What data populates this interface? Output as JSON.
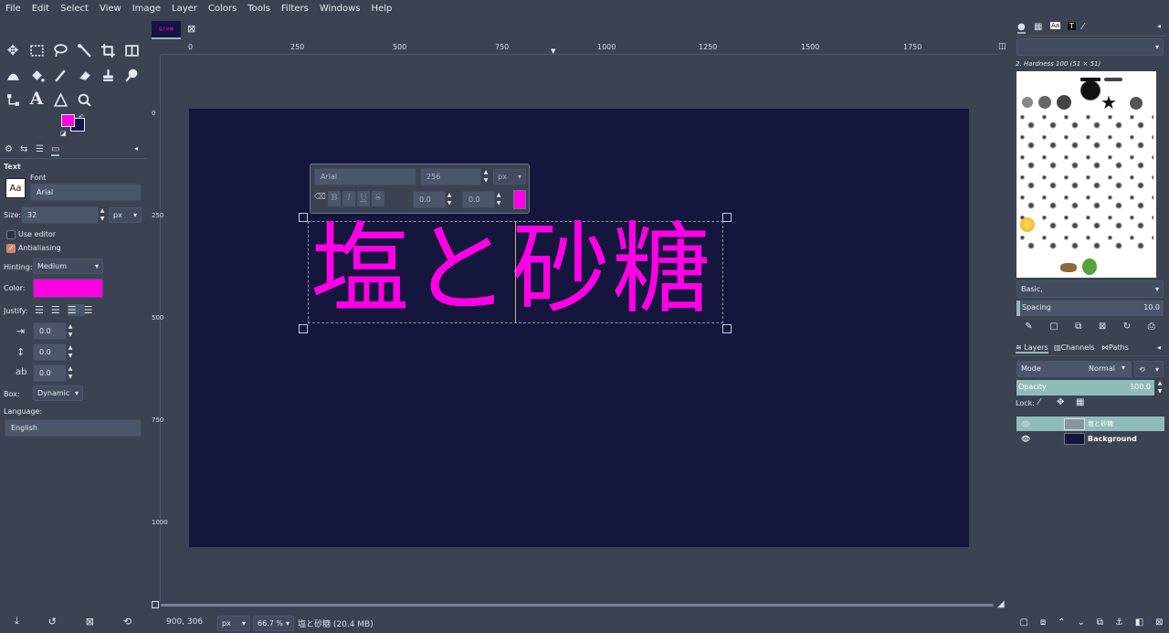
{
  "menu": [
    "File",
    "Edit",
    "Select",
    "View",
    "Image",
    "Layer",
    "Colors",
    "Tools",
    "Filters",
    "Windows",
    "Help"
  ],
  "colors": {
    "fg": "#ff00e6",
    "bg": "#14163e",
    "accent": "#8fbcbb"
  },
  "tool_options": {
    "title": "Text",
    "font_label": "Font",
    "font_value": "Arial",
    "font_icon": "Aa",
    "size_label": "Size:",
    "size_value": "32",
    "size_unit": "px",
    "use_editor": "Use editor",
    "antialiasing": "Antialiasing",
    "hinting_label": "Hinting:",
    "hinting_value": "Medium",
    "color_label": "Color:",
    "justify_label": "Justify:",
    "indent_value": "0.0",
    "line_spacing_value": "0.0",
    "letter_spacing_value": "0.0",
    "box_label": "Box:",
    "box_value": "Dynamic",
    "language_label": "Language:",
    "language_value": "English"
  },
  "image_tab": {
    "thumb_text": "塩と砂糖"
  },
  "ruler": {
    "top": [
      "0",
      "250",
      "500",
      "750",
      "1000",
      "1250",
      "1500",
      "1750"
    ],
    "left": [
      "0",
      "250",
      "500",
      "750",
      "1000"
    ]
  },
  "canvas_text": "塩と砂糖",
  "text_toolbar": {
    "font": "Arial",
    "size": "256",
    "unit": "px",
    "bold": "B",
    "italic": "I",
    "underline": "U",
    "strike": "S",
    "baseline": "0.0",
    "kerning": "0.0"
  },
  "status": {
    "coords": "900, 306",
    "unit": "px",
    "zoom": "66.7 %",
    "info": "塩と砂糖 (20.4 MB)"
  },
  "brushes": {
    "tab_text": "Aa",
    "current": "2. Hardness 100 (51 × 51)",
    "preset": "Basic,",
    "spacing_label": "Spacing",
    "spacing_value": "10.0"
  },
  "layers": {
    "tabs": [
      "Layers",
      "Channels",
      "Paths"
    ],
    "mode_label": "Mode",
    "mode_value": "Normal",
    "opacity_label": "Opacity",
    "opacity_value": "100.0",
    "lock_label": "Lock:",
    "items": [
      {
        "name": "塩と砂糖",
        "selected": true
      },
      {
        "name": "Background",
        "selected": false
      }
    ]
  }
}
